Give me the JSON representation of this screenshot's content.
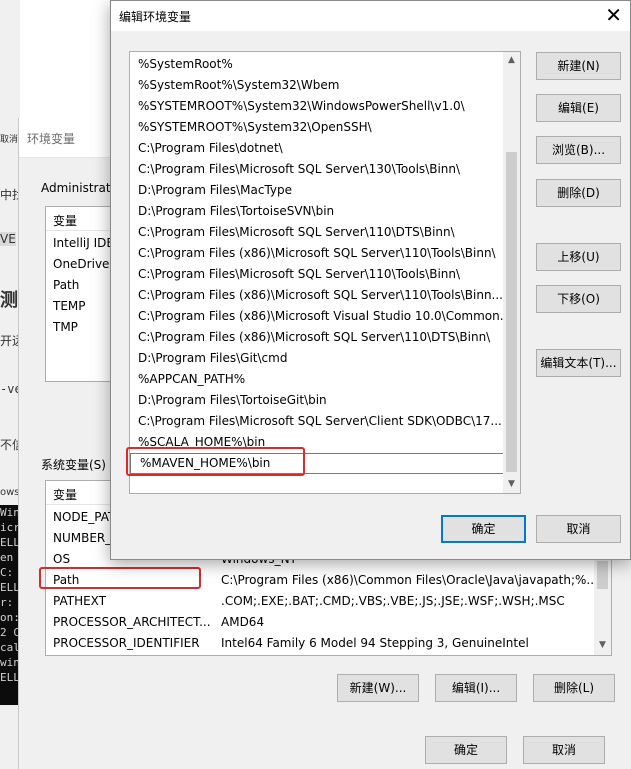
{
  "background_fragments": [
    "取消",
    "中找",
    "VE",
    "测",
    "开远",
    "-ve",
    "不信",
    "ows"
  ],
  "console_lines": [
    "Win",
    "icr",
    "",
    "ELL",
    "en",
    "C:",
    "ELL",
    "r: E",
    "on:",
    "2 C:",
    "cal",
    "win",
    "ELL"
  ],
  "env_dialog": {
    "title": "环境变量",
    "user_section_label": "Administrator",
    "user_vars_header": "变量",
    "user_vars": [
      "IntelliJ IDE",
      "OneDrive",
      "Path",
      "TEMP",
      "TMP"
    ],
    "system_section_label": "系统变量(S)",
    "sys_header_var": "变量",
    "sys_vars": [
      {
        "name": "NODE_PATH",
        "value": ""
      },
      {
        "name": "NUMBER_OF_PROCESSORS",
        "value": ""
      },
      {
        "name": "OS",
        "value": "Windows_NT"
      },
      {
        "name": "Path",
        "value": "C:\\Program Files (x86)\\Common Files\\Oracle\\Java\\javapath;%..."
      },
      {
        "name": "PATHEXT",
        "value": ".COM;.EXE;.BAT;.CMD;.VBS;.VBE;.JS;.JSE;.WSF;.WSH;.MSC"
      },
      {
        "name": "PROCESSOR_ARCHITECT...",
        "value": "AMD64"
      },
      {
        "name": "PROCESSOR_IDENTIFIER",
        "value": "Intel64 Family 6 Model 94 Stepping 3, GenuineIntel"
      }
    ],
    "new_button": "新建(W)...",
    "edit_button": "编辑(I)...",
    "delete_button": "删除(L)",
    "ok_button": "确定",
    "cancel_button": "取消"
  },
  "edit_dialog": {
    "title": "编辑环境变量",
    "close_glyph": "✕",
    "entries": [
      "%SystemRoot%",
      "%SystemRoot%\\System32\\Wbem",
      "%SYSTEMROOT%\\System32\\WindowsPowerShell\\v1.0\\",
      "%SYSTEMROOT%\\System32\\OpenSSH\\",
      "C:\\Program Files\\dotnet\\",
      "C:\\Program Files\\Microsoft SQL Server\\130\\Tools\\Binn\\",
      "D:\\Program Files\\MacType",
      "D:\\Program Files\\TortoiseSVN\\bin",
      "C:\\Program Files\\Microsoft SQL Server\\110\\DTS\\Binn\\",
      "C:\\Program Files (x86)\\Microsoft SQL Server\\110\\Tools\\Binn\\",
      "C:\\Program Files\\Microsoft SQL Server\\110\\Tools\\Binn\\",
      "C:\\Program Files (x86)\\Microsoft SQL Server\\110\\Tools\\Binn...",
      "C:\\Program Files (x86)\\Microsoft Visual Studio 10.0\\Common...",
      "C:\\Program Files (x86)\\Microsoft SQL Server\\110\\DTS\\Binn\\",
      "D:\\Program Files\\Git\\cmd",
      "%APPCAN_PATH%",
      "D:\\Program Files\\TortoiseGit\\bin",
      "C:\\Program Files\\Microsoft SQL Server\\Client SDK\\ODBC\\17...",
      "%SCALA_HOME%\\bin",
      "%MAVEN_HOME%\\bin"
    ],
    "editing_index": 19,
    "buttons": {
      "new": "新建(N)",
      "edit": "编辑(E)",
      "browse": "浏览(B)...",
      "delete": "删除(D)",
      "move_up": "上移(U)",
      "move_down": "下移(O)",
      "edit_text": "编辑文本(T)..."
    },
    "ok_button": "确定",
    "cancel_button": "取消"
  },
  "colors": {
    "highlight_box": "#e0272a",
    "default_button_border": "#0078d7",
    "dialog_bg": "#f0f0f0"
  }
}
